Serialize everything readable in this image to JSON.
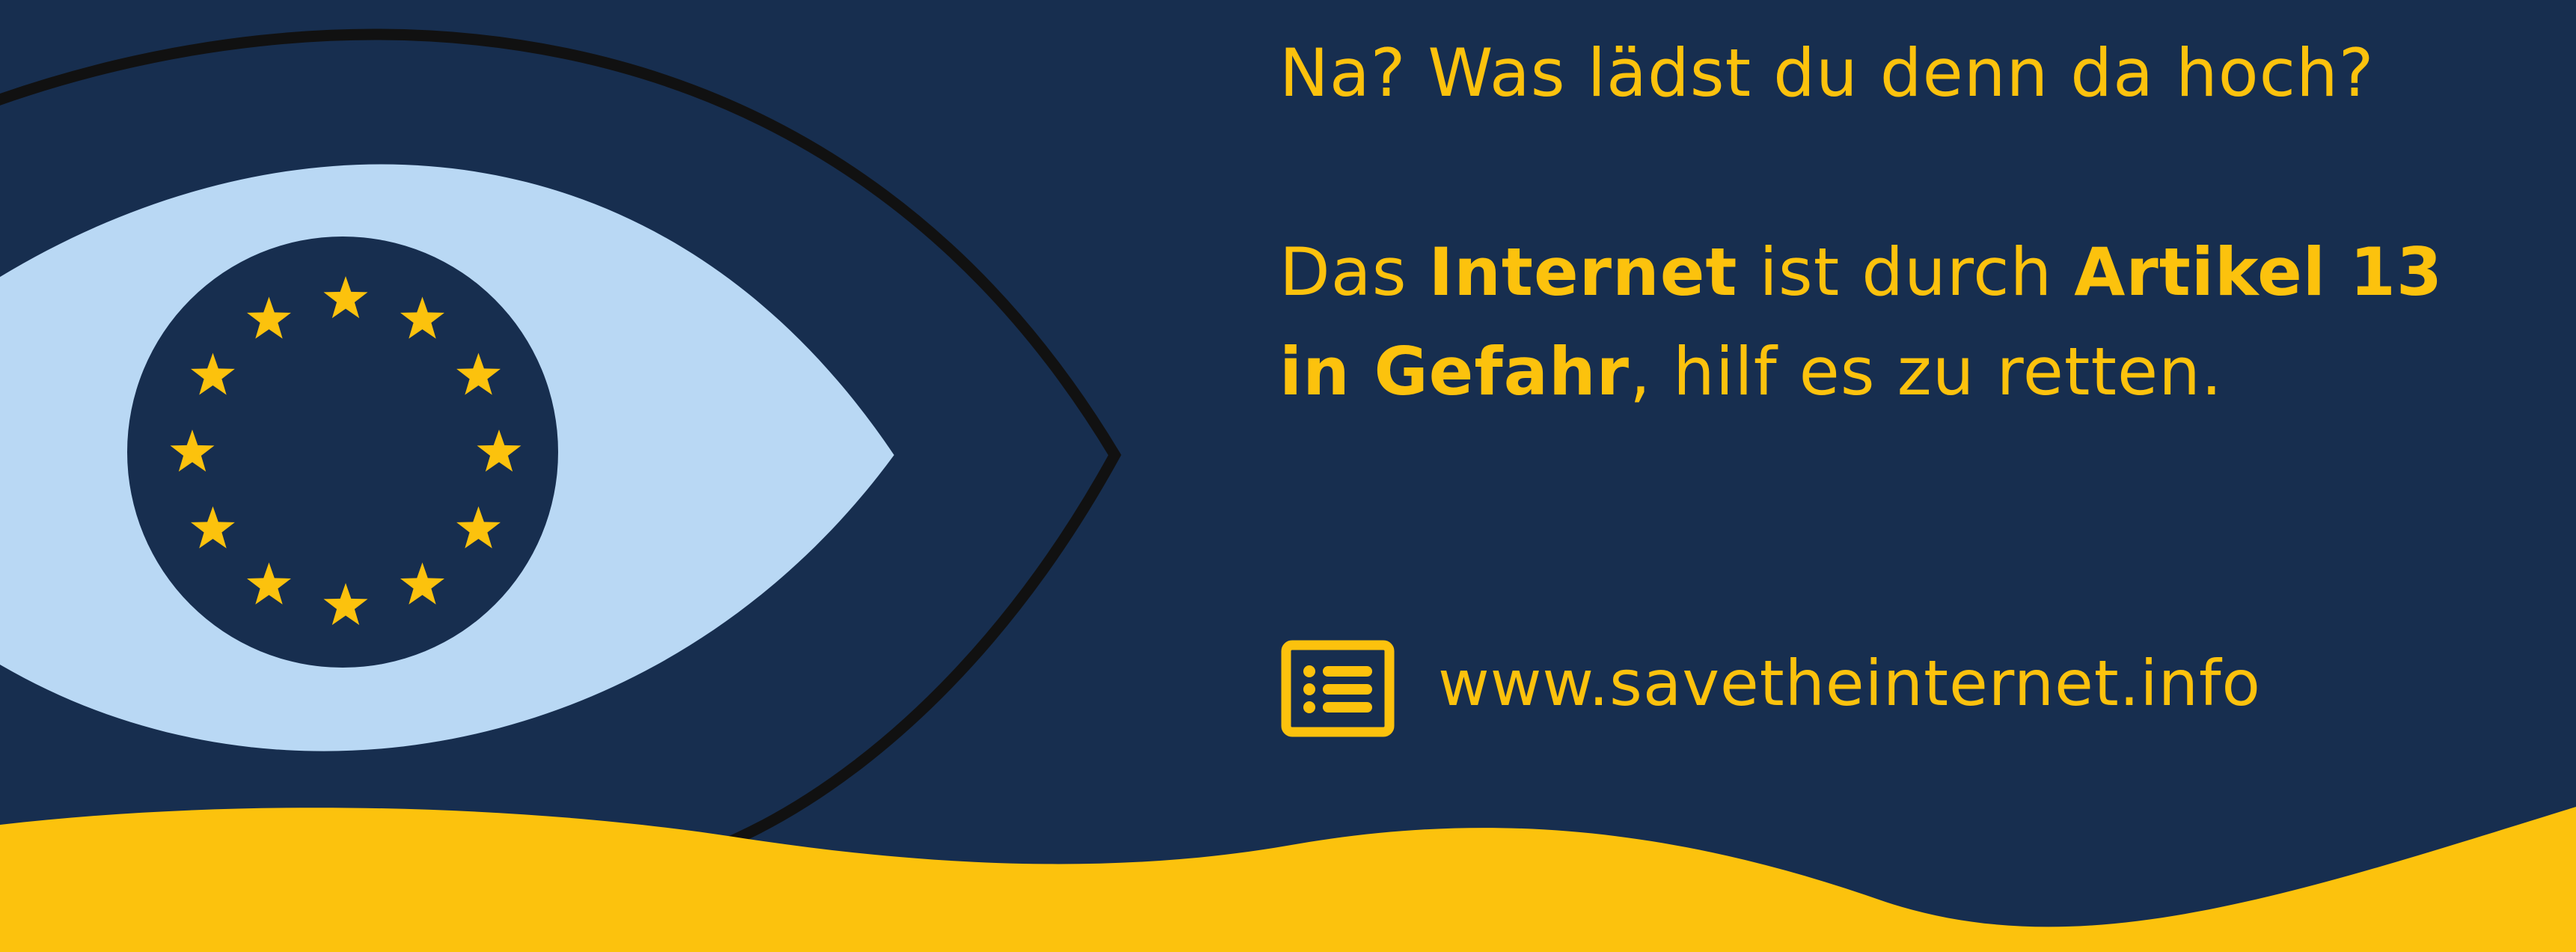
{
  "question": "Na? Was lädst du denn da hoch?",
  "message": {
    "part1": "Das ",
    "bold1": "Internet",
    "part2": " ist durch ",
    "bold2": "Artikel 13",
    "bold3": "in Gefahr",
    "part3": ", hilf es zu retten."
  },
  "website": {
    "url": "www.savetheinternet.info",
    "icon": "list-document-icon"
  },
  "colors": {
    "background": "#172e4f",
    "accent": "#fcc20d",
    "eye_white": "#b9d8f4",
    "outline": "#111111"
  }
}
